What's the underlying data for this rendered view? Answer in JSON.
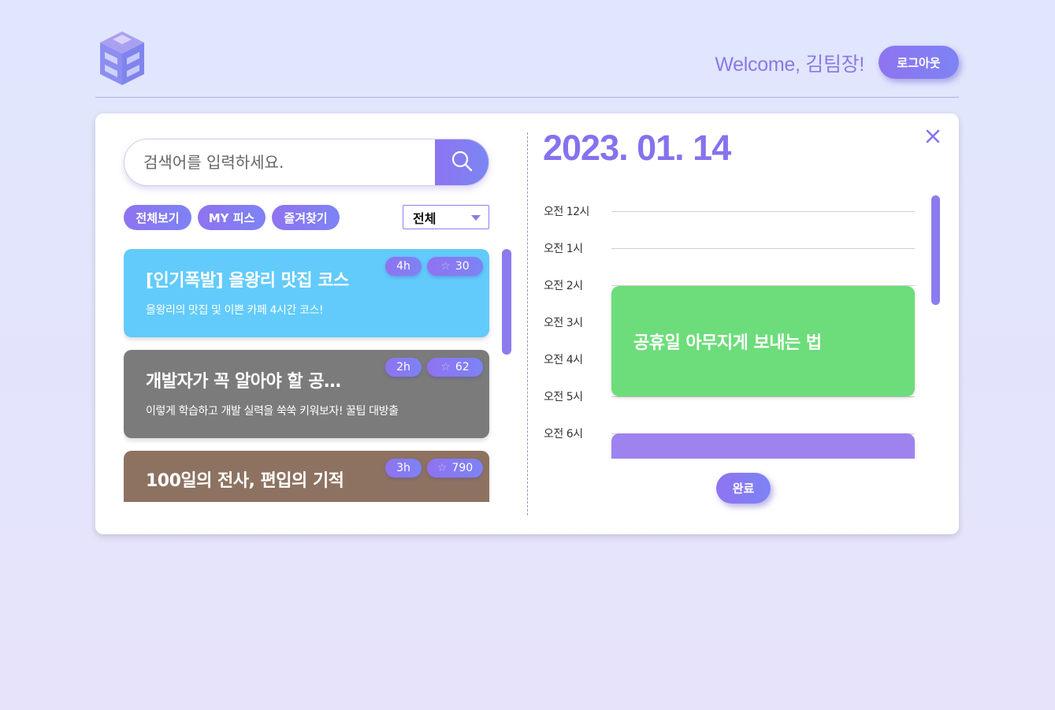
{
  "header": {
    "logo_icon": "cube-logo-icon",
    "welcome": "Welcome, 김팀장!",
    "logout_label": "로그아웃"
  },
  "search": {
    "placeholder": "검색어를 입력하세요.",
    "button_icon": "search-icon"
  },
  "filters": {
    "chips": [
      {
        "label": "전체보기"
      },
      {
        "label": "MY 피스"
      },
      {
        "label": "즐겨찾기"
      }
    ],
    "select_value": "전체"
  },
  "courses": [
    {
      "title": "[인기폭발] 을왕리 맛집 코스",
      "desc": "을왕리의 맛집 및 이쁜 카페 4시간 코스!",
      "duration": "4h",
      "stars": "30",
      "color": "#62cbfb"
    },
    {
      "title": "개발자가 꼭 알아야 할 공…",
      "desc": "이렇게 학습하고 개발 실력을 쑥쑥 키워보자! 꿀팁 대방출",
      "duration": "2h",
      "stars": "62",
      "color": "#7b7b7b"
    },
    {
      "title": "100일의 전사, 편입의 기적",
      "desc": "",
      "duration": "3h",
      "stars": "790",
      "color": "#8e7261"
    }
  ],
  "schedule": {
    "date": "2023. 01. 14",
    "hours": [
      "오전 12시",
      "오전 1시",
      "오전 2시",
      "오전 3시",
      "오전 4시",
      "오전 5시",
      "오전 6시"
    ],
    "events": [
      {
        "title": "공휴일 아무지게 보내는 법",
        "color": "#6cdd7a"
      },
      {
        "title": "",
        "color": "#9e83ee"
      }
    ],
    "done_label": "완료"
  },
  "colors": {
    "accent": "#8672ee",
    "background": "#e0e6fd"
  }
}
